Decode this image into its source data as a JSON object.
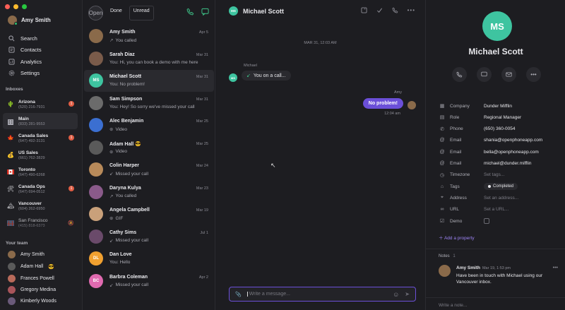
{
  "colors": {
    "accent": "#6b4fd8",
    "unread": "#e05d44",
    "online": "#2fbf71"
  },
  "user": {
    "name": "Amy Smith"
  },
  "nav": [
    {
      "icon": "search-icon",
      "label": "Search"
    },
    {
      "icon": "contacts-icon",
      "label": "Contacts"
    },
    {
      "icon": "analytics-icon",
      "label": "Analytics"
    },
    {
      "icon": "gear-icon",
      "label": "Settings"
    }
  ],
  "inboxes_title": "Inboxes",
  "inboxes": [
    {
      "flag": "cactus",
      "name": "Arizona",
      "phone": "(520) 216-7931",
      "badge": "1"
    },
    {
      "flag": "building",
      "name": "Main",
      "phone": "(833) 281-9553",
      "badge": ""
    },
    {
      "flag": "maple",
      "name": "Canada Sales",
      "phone": "(647) 492-3131",
      "badge": "1"
    },
    {
      "flag": "money",
      "name": "US Sales",
      "phone": "(661) 762-3829",
      "badge": ""
    },
    {
      "flag": "canada",
      "name": "Toronto",
      "phone": "(647) 490-6268",
      "badge": ""
    },
    {
      "flag": "tools",
      "name": "Canada Ops",
      "phone": "(647) 694-0512",
      "badge": "1"
    },
    {
      "flag": "mountain",
      "name": "Vancouver",
      "phone": "(604) 262-6950",
      "badge": ""
    },
    {
      "flag": "bridge",
      "name": "San Francisco",
      "phone": "(415) 818-6373",
      "badge": ""
    }
  ],
  "team_title": "Your team",
  "team": [
    {
      "name": "Amy Smith",
      "emoji": ""
    },
    {
      "name": "Adam Hall",
      "emoji": "😎"
    },
    {
      "name": "Frances Powell",
      "emoji": ""
    },
    {
      "name": "Gregory Medina",
      "emoji": ""
    },
    {
      "name": "Kimberly Woods",
      "emoji": ""
    }
  ],
  "list": {
    "tabs": [
      "Open",
      "Done",
      "Unread"
    ]
  },
  "conversations": [
    {
      "name": "Amy Smith",
      "date": "Apr 5",
      "preview": "You called",
      "icon": "outgoing-call-icon",
      "initials": "",
      "color": "#8a6a4a"
    },
    {
      "name": "Sarah Diaz",
      "date": "Mar 31",
      "preview": "You: Hi, you can book a demo with me here",
      "icon": "",
      "initials": "",
      "color": "#7a5b4a"
    },
    {
      "name": "Michael Scott",
      "date": "Mar 31",
      "preview": "You: No problem!",
      "icon": "",
      "initials": "MS",
      "color": "#3ec4a0"
    },
    {
      "name": "Sam Simpson",
      "date": "Mar 31",
      "preview": "You: Hey! So sorry we've missed your call",
      "icon": "",
      "initials": "",
      "color": "#6b6b6b"
    },
    {
      "name": "Alec Benjamin",
      "date": "Mar 25",
      "preview": "Video",
      "icon": "attachment-icon",
      "initials": "",
      "color": "#3b6fd1"
    },
    {
      "name": "Adam Hall 😎",
      "date": "Mar 25",
      "preview": "Video",
      "icon": "attachment-icon",
      "initials": "",
      "color": "#5a5a5a"
    },
    {
      "name": "Colin Harper",
      "date": "Mar 24",
      "preview": "Missed your call",
      "icon": "missed-call-icon",
      "initials": "",
      "color": "#b88a5a"
    },
    {
      "name": "Daryna Kulya",
      "date": "Mar 23",
      "preview": "You called",
      "icon": "outgoing-call-icon",
      "initials": "",
      "color": "#8a5a8a"
    },
    {
      "name": "Angela Campbell",
      "date": "Mar 19",
      "preview": "GIF",
      "icon": "attachment-icon",
      "initials": "",
      "color": "#c9a07a"
    },
    {
      "name": "Cathy Sims",
      "date": "Jul 1",
      "preview": "Missed your call",
      "icon": "missed-call-icon",
      "initials": "",
      "color": "#6a4a6a"
    },
    {
      "name": "Dan Love",
      "date": "",
      "preview": "You: Hello",
      "icon": "",
      "initials": "DL",
      "color": "#f0a030"
    },
    {
      "name": "Barbra Coleman",
      "date": "Apr 2",
      "preview": "Missed your call",
      "icon": "missed-call-icon",
      "initials": "BC",
      "color": "#e06ab0"
    }
  ],
  "chat": {
    "title": "Michael Scott",
    "initials": "MS",
    "date_sep": "MAR 31, 12:03 AM",
    "in_label": "Michael",
    "in_text": "You on a call...",
    "out_label": "Amy",
    "out_text": "No problem!",
    "out_time": "12:04 am",
    "composer_placeholder": "Write a message..."
  },
  "contact": {
    "initials": "MS",
    "name": "Michael Scott",
    "props": [
      {
        "icon": "company-icon",
        "key": "Company",
        "value": "Dunder Mifflin",
        "placeholder": false
      },
      {
        "icon": "role-icon",
        "key": "Role",
        "value": "Regional Manager",
        "placeholder": false
      },
      {
        "icon": "phone-icon",
        "key": "Phone",
        "value": "(650) 360-0054",
        "placeholder": false
      },
      {
        "icon": "at-icon",
        "key": "Email",
        "value": "shania@openphoneapp.com",
        "placeholder": false
      },
      {
        "icon": "at-icon",
        "key": "Email",
        "value": "bella@openphoneapp.com",
        "placeholder": false
      },
      {
        "icon": "at-icon",
        "key": "Email",
        "value": "michael@dunder.mifflin",
        "placeholder": false
      },
      {
        "icon": "clock-icon",
        "key": "Timezone",
        "value": "Set tags...",
        "placeholder": true
      },
      {
        "icon": "tag-icon",
        "key": "Tags",
        "value": "Completed",
        "placeholder": false
      },
      {
        "icon": "location-icon",
        "key": "Address",
        "value": "Set an address...",
        "placeholder": true
      },
      {
        "icon": "link-icon",
        "key": "URL",
        "value": "Set a URL...",
        "placeholder": true
      },
      {
        "icon": "checkbox-icon",
        "key": "Demo",
        "value": "",
        "placeholder": false
      }
    ],
    "add_property": "Add a property",
    "notes_title": "Notes",
    "notes_count": "1",
    "note": {
      "author": "Amy Smith",
      "date": "Mar 19, 1:53 pm",
      "text": "Have been in touch with Michael using our Vancouver inbox."
    },
    "note_placeholder": "Write a note..."
  }
}
